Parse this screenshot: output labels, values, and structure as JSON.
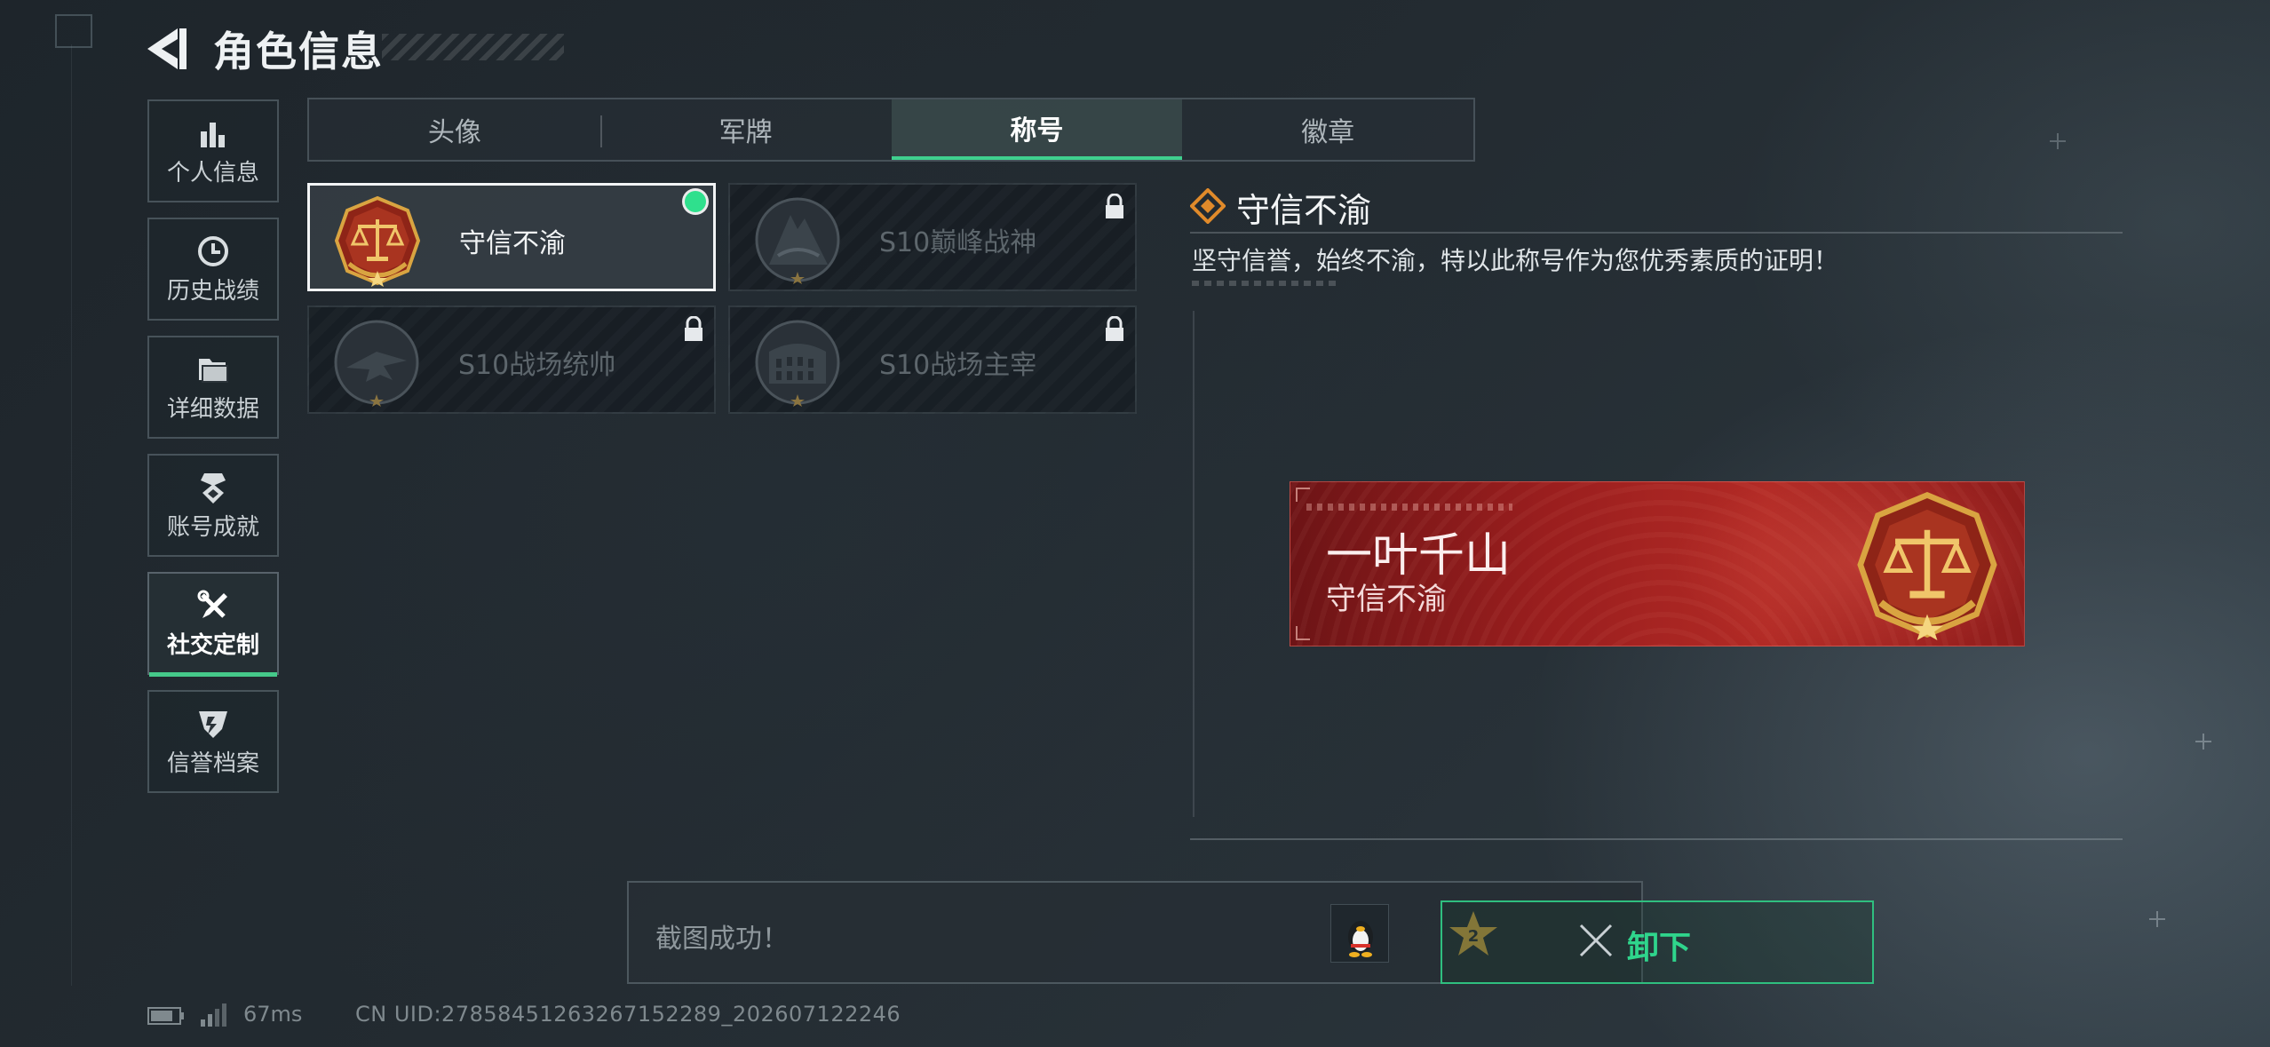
{
  "header": {
    "title": "角色信息"
  },
  "sidebar": {
    "items": [
      {
        "label": "个人信息",
        "icon": "bar-chart-icon"
      },
      {
        "label": "历史战绩",
        "icon": "clock-icon"
      },
      {
        "label": "详细数据",
        "icon": "folder-icon"
      },
      {
        "label": "账号成就",
        "icon": "medal-icon"
      },
      {
        "label": "社交定制",
        "icon": "tools-icon",
        "active": true
      },
      {
        "label": "信誉档案",
        "icon": "shield-badge-icon"
      }
    ]
  },
  "tabs": [
    {
      "label": "头像"
    },
    {
      "label": "军牌"
    },
    {
      "label": "称号",
      "active": true
    },
    {
      "label": "徽章"
    }
  ],
  "titles": [
    {
      "name": "守信不渝",
      "selected": true,
      "locked": false,
      "icon": "scales-emblem-icon"
    },
    {
      "name": "S10巅峰战神",
      "selected": false,
      "locked": true,
      "icon": "peak-emblem-icon"
    },
    {
      "name": "S10战场统帅",
      "selected": false,
      "locked": true,
      "icon": "jet-emblem-icon"
    },
    {
      "name": "S10战场主宰",
      "selected": false,
      "locked": true,
      "icon": "colosseum-emblem-icon"
    }
  ],
  "detail": {
    "title": "守信不渝",
    "description": "坚守信誉，始终不渝，特以此称号作为您优秀素质的证明！"
  },
  "nameplate": {
    "player_name": "一叶千山",
    "title": "守信不渝"
  },
  "toast": {
    "message": "截图成功！"
  },
  "actions": {
    "unequip_label": "卸下"
  },
  "status": {
    "ping": "67ms",
    "uid": "CN UID:2785845126326715​2289_202607122246"
  },
  "colors": {
    "accent_green": "#3fd08e",
    "nameplate_red": "#9a1e1e",
    "emblem_gold": "#d9a441"
  }
}
